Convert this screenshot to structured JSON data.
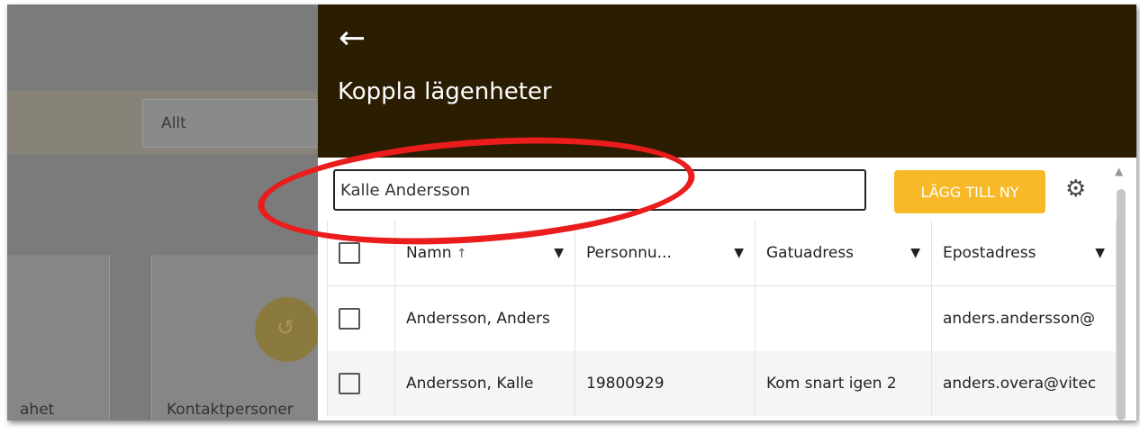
{
  "background": {
    "select_value": "Allt",
    "card_left_label": "ahet",
    "card_right_label": "Kontaktpersoner"
  },
  "panel": {
    "title": "Koppla lägenheter",
    "back_icon": "arrow-left-icon",
    "search_value": "Kalle Andersson",
    "add_button_label": "LÄGG TILL NY",
    "settings_icon": "gear-icon",
    "accent_color": "#f7b927",
    "header_color": "#2b1d02"
  },
  "table": {
    "columns": [
      "Namn",
      "Personnu...",
      "Gatuadress",
      "Epostadress"
    ],
    "rows": [
      {
        "name": "Andersson, Anders",
        "personnummer": "",
        "gatuadress": "",
        "epost": "anders.andersson@"
      },
      {
        "name": "Andersson, Kalle",
        "personnummer": "19800929",
        "gatuadress": "Kom snart igen 2",
        "epost": "anders.overa@vitec"
      }
    ]
  },
  "annotation_color": "#ea1c1c"
}
